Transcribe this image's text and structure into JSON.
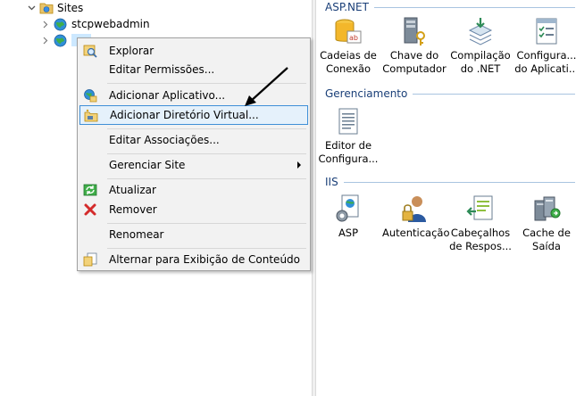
{
  "tree": {
    "sites_label": "Sites",
    "items": [
      {
        "label": "stcpwebadmin"
      },
      {
        "label": "lab"
      }
    ]
  },
  "context_menu": {
    "items": [
      {
        "label": "Explorar",
        "icon": "explore-icon"
      },
      {
        "label": "Editar Permissões...",
        "icon": ""
      },
      {
        "label": "Adicionar Aplicativo...",
        "icon": "add-application-icon"
      },
      {
        "label": "Adicionar Diretório Virtual...",
        "icon": "add-virtual-directory-icon",
        "highlighted": true
      },
      {
        "label": "Editar Associações...",
        "icon": ""
      },
      {
        "label": "Gerenciar Site",
        "icon": "",
        "submenu": true
      },
      {
        "label": "Atualizar",
        "icon": "refresh-icon"
      },
      {
        "label": "Remover",
        "icon": "remove-icon"
      },
      {
        "label": "Renomear",
        "icon": ""
      },
      {
        "label": "Alternar para Exibição de Conteúdo",
        "icon": "content-view-icon"
      }
    ]
  },
  "features": {
    "groups": [
      {
        "title": "ASP.NET",
        "tiles": [
          {
            "line1": "Cadeias de",
            "line2": "Conexão",
            "icon": "connection-strings-icon"
          },
          {
            "line1": "Chave do",
            "line2": "Computador",
            "icon": "machine-key-icon"
          },
          {
            "line1": "Compilação",
            "line2": "do .NET",
            "icon": "net-compilation-icon"
          },
          {
            "line1": "Configura...",
            "line2": "do Aplicati...",
            "icon": "app-settings-icon"
          }
        ]
      },
      {
        "title": "Gerenciamento",
        "tiles": [
          {
            "line1": "Editor de",
            "line2": "Configura...",
            "icon": "configuration-editor-icon"
          }
        ]
      },
      {
        "title": "IIS",
        "tiles": [
          {
            "line1": "ASP",
            "line2": "",
            "icon": "asp-icon"
          },
          {
            "line1": "Autenticação",
            "line2": "",
            "icon": "authentication-icon"
          },
          {
            "line1": "Cabeçalhos",
            "line2": "de Respos...",
            "icon": "response-headers-icon"
          },
          {
            "line1": "Cache de",
            "line2": "Saída",
            "icon": "output-cache-icon"
          }
        ]
      }
    ]
  },
  "colors": {
    "group_header": "#1a3f78",
    "menu_highlight_bg": "#e5f1fb",
    "menu_highlight_border": "#3f8fd7",
    "tree_selection": "#cce8ff"
  }
}
